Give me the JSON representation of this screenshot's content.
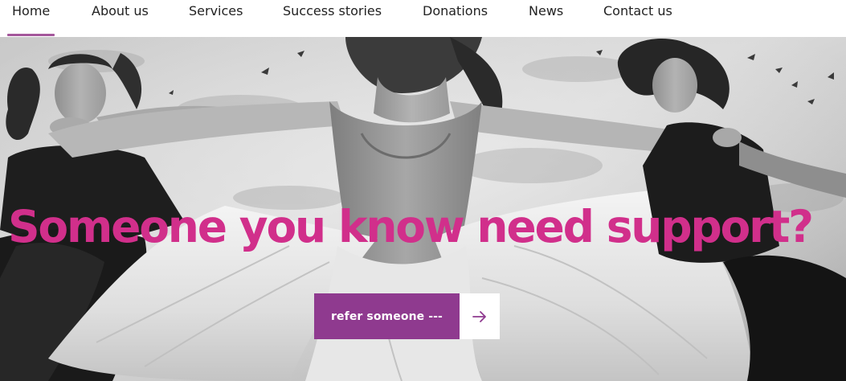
{
  "nav": {
    "items": [
      {
        "label": "Home"
      },
      {
        "label": "About us"
      },
      {
        "label": "Services"
      },
      {
        "label": "Success stories"
      },
      {
        "label": "Donations"
      },
      {
        "label": "News"
      },
      {
        "label": "Contact us"
      }
    ],
    "active": "Home"
  },
  "hero": {
    "heading": "Someone you know need support?",
    "cta_label": "refer someone ---",
    "cta_icon": "arrow-right-icon"
  },
  "colors": {
    "accent_pink": "#d12f8b",
    "button_purple": "#8f3a8f",
    "nav_underline": "#a4579b",
    "nav_text": "#222222"
  }
}
